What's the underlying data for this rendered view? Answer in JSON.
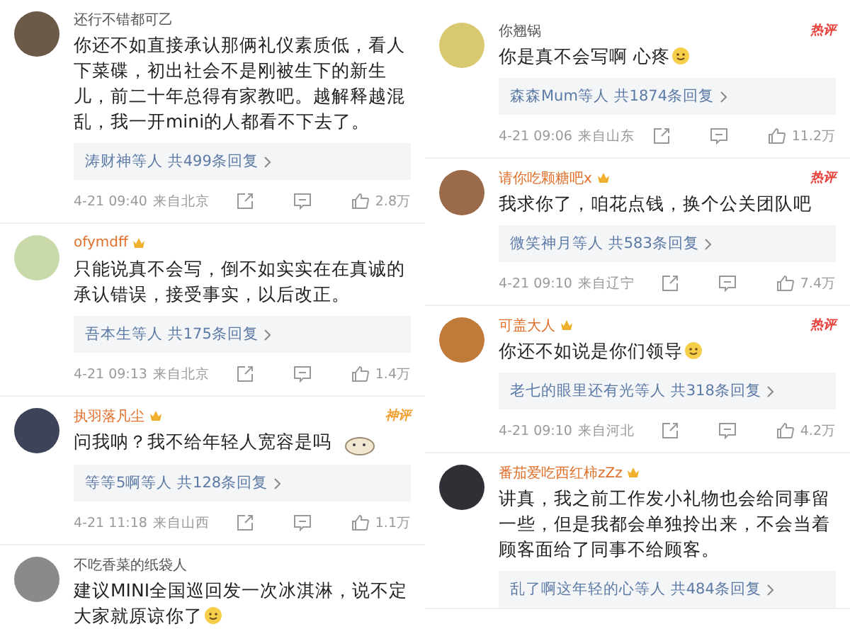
{
  "columns": [
    {
      "comments": [
        {
          "name": "还行不错都可乙",
          "vip": false,
          "text": "你还不如直接承认那俩礼仪素质低，看人下菜碟，初出社会不是刚被生下的新生儿，前二十年总得有家教吧。越解释越混乱，我一开mini的人都看不下去了。",
          "replies": "涛财神等人 共499条回复",
          "time": "4-21 09:40",
          "location": "来自北京",
          "likes": "2.8万"
        },
        {
          "name": "ofymdff",
          "vip": true,
          "text": "只能说真不会写，倒不如实实在在真诚的承认错误，接受事实，以后改正。",
          "replies": "吾本生等人 共175条回复",
          "time": "4-21 09:13",
          "location": "来自北京",
          "likes": "1.4万"
        },
        {
          "name": "执羽落凡尘",
          "vip": true,
          "tag": {
            "label": "神评",
            "color": "#f0a030"
          },
          "text": "问我呐？我不给年轻人宽容是吗",
          "sticker": {
            "kind": "cat"
          },
          "replies": "等等5啊等人 共128条回复",
          "time": "4-21 11:18",
          "location": "来自山西",
          "likes": "1.1万"
        },
        {
          "name": "不吃香菜的纸袋人",
          "vip": false,
          "text": "建议MINI全国巡回发一次冰淇淋，说不定大家就原谅你了",
          "sticker": {
            "kind": "face"
          }
        }
      ]
    },
    {
      "comments": [
        {
          "name": "你翘锅",
          "vip": false,
          "tag": {
            "label": "热评",
            "color": "#e8423c"
          },
          "text": "你是真不会写啊 心疼",
          "sticker": {
            "kind": "face"
          },
          "replies": "森森Mum等人 共1874条回复",
          "time": "4-21 09:06",
          "location": "来自山东",
          "likes": "11.2万"
        },
        {
          "name": "请你吃颗糖吧x",
          "vip": true,
          "tag": {
            "label": "热评",
            "color": "#e8423c"
          },
          "text": "我求你了，咱花点钱，换个公关团队吧",
          "replies": "微笑神月等人 共583条回复",
          "time": "4-21 09:10",
          "location": "来自辽宁",
          "likes": "7.4万"
        },
        {
          "name": "可盖大人",
          "vip": true,
          "tag": {
            "label": "热评",
            "color": "#e8423c"
          },
          "text": "你还不如说是你们领导",
          "sticker": {
            "kind": "face"
          },
          "replies": "老七的眼里还有光等人 共318条回复",
          "time": "4-21 09:10",
          "location": "来自河北",
          "likes": "4.2万"
        },
        {
          "name": "番茄爱吃西红柿zZz",
          "vip": true,
          "text": "讲真，我之前工作发小礼物也会给同事留一些，但是我都会单独拎出来，不会当着顾客面给了同事不给顾客。",
          "replies": "乱了啊这年轻的心等人 共484条回复"
        }
      ]
    }
  ]
}
